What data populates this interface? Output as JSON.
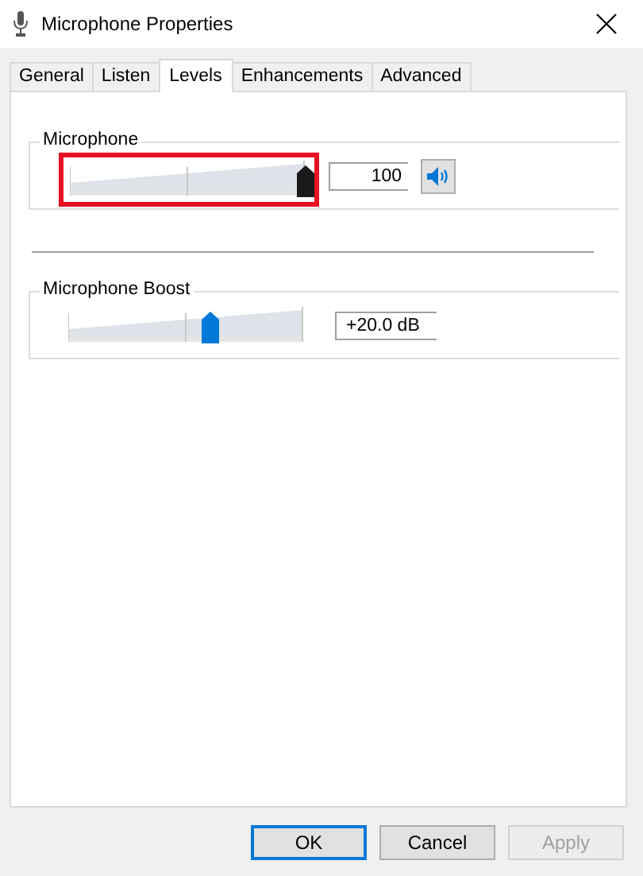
{
  "window": {
    "title": "Microphone Properties"
  },
  "tabs": [
    {
      "label": "General",
      "selected": false
    },
    {
      "label": "Listen",
      "selected": false
    },
    {
      "label": "Levels",
      "selected": true
    },
    {
      "label": "Enhancements",
      "selected": false
    },
    {
      "label": "Advanced",
      "selected": false
    }
  ],
  "groups": [
    {
      "title": "Microphone",
      "level": 1,
      "focused": true,
      "highlighted": true,
      "reading": "100",
      "mute_button": true
    },
    {
      "title": "Microphone Boost",
      "level": 0.6,
      "focused": false,
      "highlighted": false,
      "reading": "+20.0 dB",
      "mute_button": false
    }
  ],
  "buttons": [
    {
      "label": "OK",
      "default": true,
      "disabled": false
    },
    {
      "label": "Cancel",
      "default": false,
      "disabled": false
    },
    {
      "label": "Apply",
      "default": false,
      "disabled": true
    }
  ]
}
